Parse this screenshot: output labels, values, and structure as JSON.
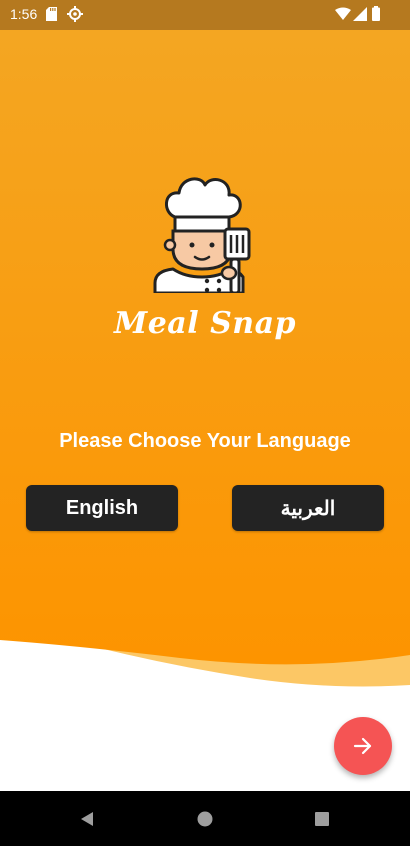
{
  "status_bar": {
    "time": "1:56",
    "icons": [
      "sd-card-icon",
      "gear-icon",
      "wifi-icon",
      "signal-icon",
      "battery-icon"
    ]
  },
  "app": {
    "title": "Meal Snap",
    "logo_icon": "chef-icon",
    "prompt": "Please Choose Your Language"
  },
  "languages": {
    "english": "English",
    "arabic": "العربية"
  },
  "next_button": {
    "icon": "arrow-right-icon"
  },
  "nav_bar": {
    "icons": [
      "back-icon",
      "home-icon",
      "recent-apps-icon"
    ]
  },
  "colors": {
    "status_bar": "#b5791f",
    "gradient_top": "#f4a622",
    "gradient_bottom": "#fd9400",
    "button_bg": "#232323",
    "fab": "#f55454"
  }
}
